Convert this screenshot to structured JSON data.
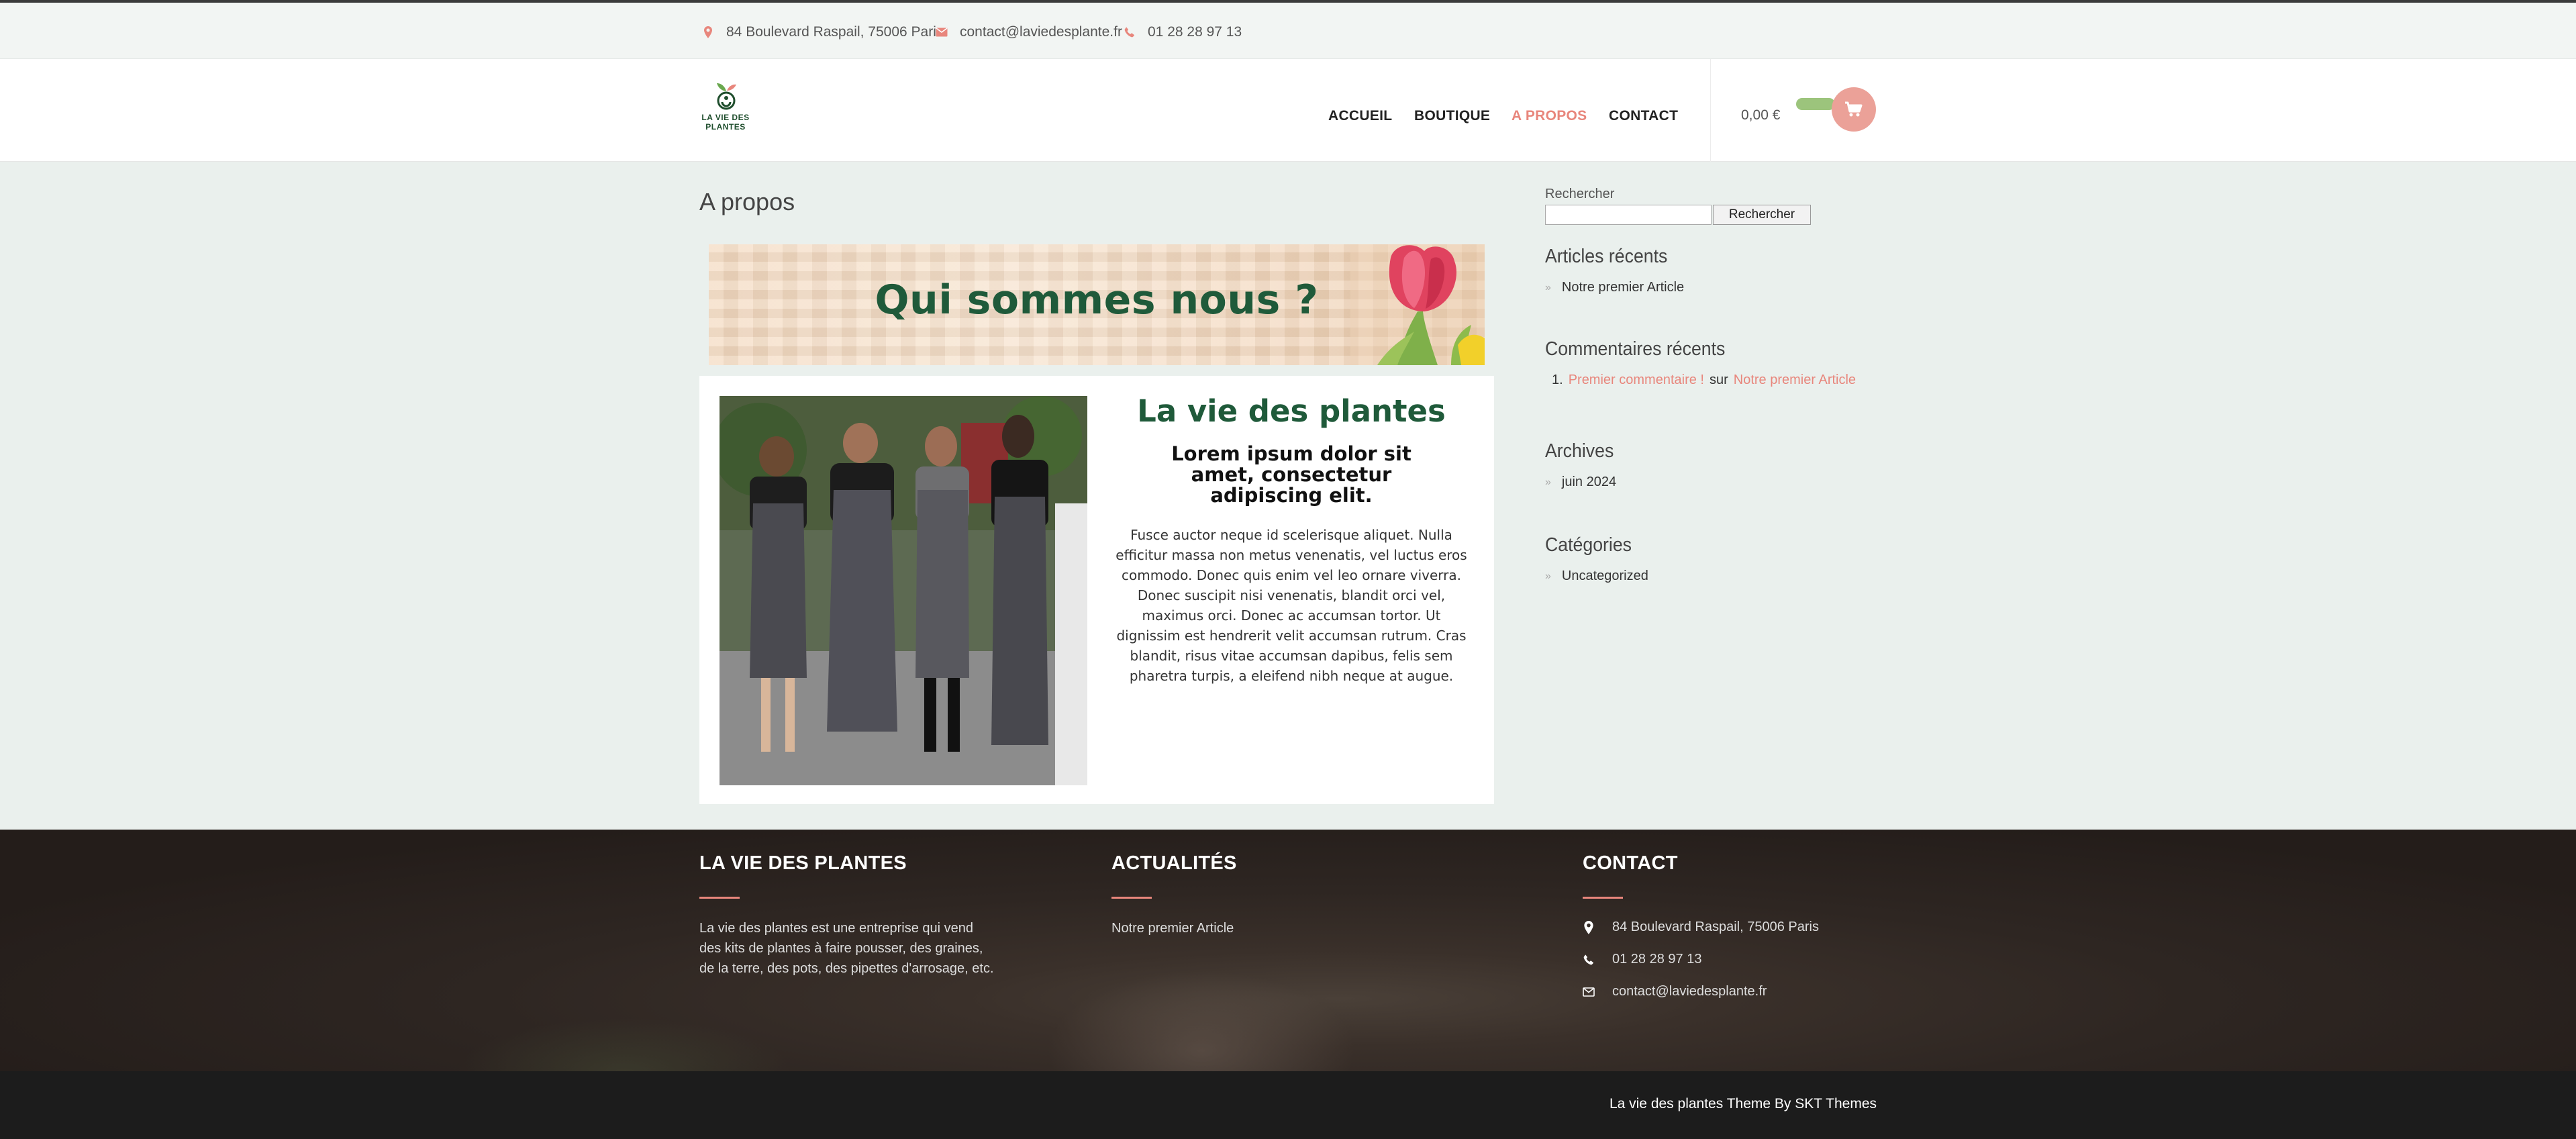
{
  "topbar": {
    "address": "84 Boulevard Raspail, 75006 Paris",
    "email": "contact@laviedesplante.fr",
    "phone": "01 28 28 97 13",
    "icons": [
      "map-pin-icon",
      "envelope-icon",
      "phone-icon"
    ]
  },
  "header": {
    "logo_text_line1": "LA VIE DES",
    "logo_text_line2": "PLANTES",
    "nav": [
      "ACCUEIL",
      "BOUTIQUE",
      "A PROPOS",
      "CONTACT"
    ],
    "active_nav": "A PROPOS",
    "cart_total": "0,00 €"
  },
  "main": {
    "page_title": "A propos",
    "banner_title": "Qui sommes nous ?",
    "heading": "La vie des plantes",
    "subheading": "Lorem ipsum dolor sit amet, consectetur adipiscing elit.",
    "paragraph": "Fusce auctor neque id scelerisque aliquet. Nulla efficitur massa non metus venenatis, vel luctus eros commodo. Donec quis enim vel leo ornare viverra. Donec suscipit nisi venenatis, blandit orci vel, maximus orci. Donec ac accumsan tortor. Ut dignissim est hendrerit velit accumsan rutrum. Cras blandit, risus vitae accumsan dapibus, felis sem pharetra turpis, a eleifend nibh neque at augue."
  },
  "sidebar": {
    "search_label": "Rechercher",
    "search_button": "Rechercher",
    "recent_posts_title": "Articles récents",
    "recent_posts": [
      "Notre premier Article"
    ],
    "recent_comments_title": "Commentaires récents",
    "recent_comment": {
      "number": "1.",
      "author": "Premier commentaire !",
      "on": "sur",
      "post": "Notre premier Article"
    },
    "archives_title": "Archives",
    "archives": [
      "juin 2024"
    ],
    "categories_title": "Catégories",
    "categories": [
      "Uncategorized"
    ]
  },
  "footer": {
    "col1_title": "LA VIE DES PLANTES",
    "col1_text": "La vie des plantes est une entreprise qui vend des kits de plantes à faire pousser, des graines, de la terre, des pots, des pipettes d'arrosage, etc.",
    "col2_title": "ACTUALITÉS",
    "col2_item": "Notre premier Article",
    "col3_title": "CONTACT",
    "address": "84 Boulevard Raspail, 75006 Paris",
    "phone": "01 28 28 97 13",
    "email": "contact@laviedesplante.fr",
    "credit": "La vie des plantes Theme By SKT Themes"
  },
  "colors": {
    "accent": "#e8867c",
    "brand_green": "#1f5a3a",
    "page_bg": "#eaf0ed",
    "footer_bg": "#2e2622"
  }
}
